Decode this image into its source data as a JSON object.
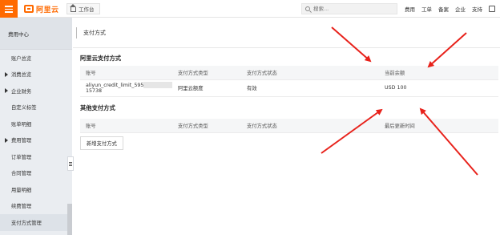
{
  "brand": {
    "logo_text": "阿里云",
    "accent": "#ff6a00"
  },
  "header": {
    "workbench_label": "工作台",
    "search_placeholder": "搜索...",
    "nav": [
      "费用",
      "工单",
      "备案",
      "企业",
      "支持"
    ]
  },
  "sidebar": {
    "title": "费用中心",
    "items": [
      {
        "label": "账户总览",
        "expandable": false
      },
      {
        "label": "消费总览",
        "expandable": true
      },
      {
        "label": "企业财务",
        "expandable": true
      },
      {
        "label": "自定义标签",
        "expandable": false
      },
      {
        "label": "账单明细",
        "expandable": false
      },
      {
        "label": "费用管理",
        "expandable": true
      },
      {
        "label": "订单管理",
        "expandable": false
      },
      {
        "label": "合同管理",
        "expandable": false
      },
      {
        "label": "用量明细",
        "expandable": false
      },
      {
        "label": "续费管理",
        "expandable": false
      },
      {
        "label": "支付方式管理",
        "expandable": false,
        "active": true
      }
    ]
  },
  "page": {
    "title": "支付方式"
  },
  "aliyun_methods": {
    "title": "阿里云支付方式",
    "columns": [
      "账号",
      "支付方式类型",
      "支付方式状态",
      "当前余额"
    ],
    "rows": [
      {
        "account_prefix": "aliyun_credit_limit_595",
        "account_suffix": "15738",
        "type": "阿里云额度",
        "status": "有效",
        "balance": "USD 100"
      }
    ]
  },
  "other_methods": {
    "title": "其他支付方式",
    "columns": [
      "账号",
      "支付方式类型",
      "支付方式状态",
      "最后更新时间"
    ],
    "add_button": "新增支付方式"
  },
  "annotation_color": "#e8221b"
}
